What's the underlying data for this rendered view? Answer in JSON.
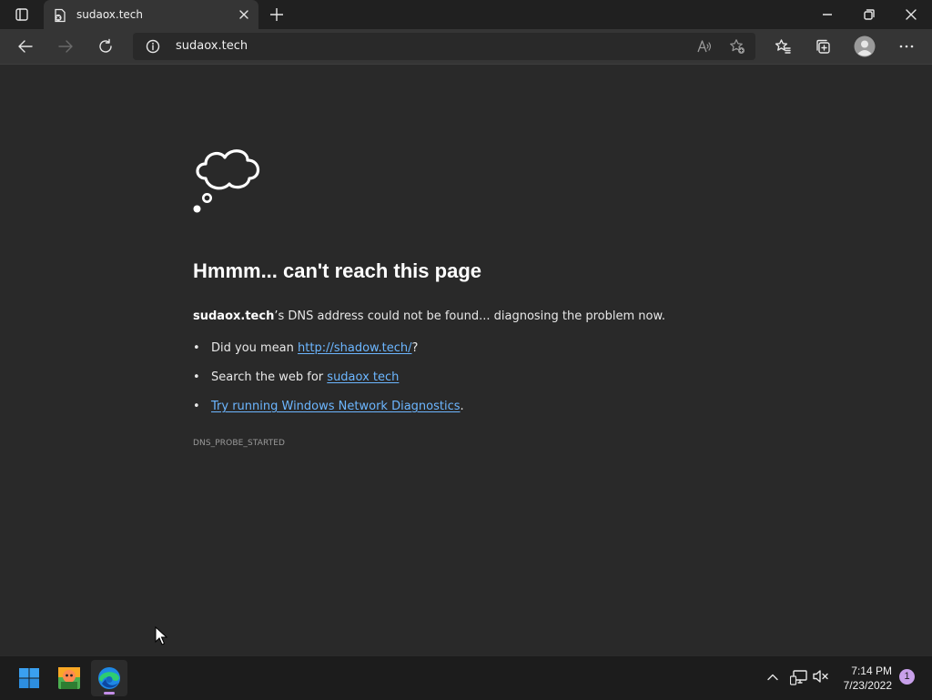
{
  "browser": {
    "tab": {
      "title": "sudaox.tech",
      "favicon": "error-page-icon"
    },
    "address_bar": {
      "url": "sudaox.tech"
    },
    "icons": {
      "tab_actions": "tab-actions-icon",
      "back": "back-icon",
      "forward": "forward-icon",
      "refresh": "refresh-icon",
      "site_info": "info-icon",
      "read_aloud": "read-aloud-icon",
      "add_favorite": "add-favorite-icon",
      "favorites": "favorites-icon",
      "collections": "collections-icon",
      "profile": "profile-icon",
      "menu": "more-icon"
    }
  },
  "error_page": {
    "icon": "thought-bubble-icon",
    "heading": "Hmmm... can't reach this page",
    "summary_host": "sudaox.tech",
    "summary_rest": "’s DNS address could not be found... diagnosing the problem now.",
    "suggestions": [
      {
        "prefix": "Did you mean ",
        "link": "http://shadow.tech/",
        "suffix": "?"
      },
      {
        "prefix": "Search the web for ",
        "link": "sudaox tech",
        "suffix": ""
      },
      {
        "prefix": "",
        "link": "Try running Windows Network Diagnostics",
        "suffix": "."
      }
    ],
    "error_code": "DNS_PROBE_STARTED"
  },
  "taskbar": {
    "apps": [
      "start-icon",
      "app-icon",
      "edge-icon"
    ],
    "tray": [
      "chevron-up-icon",
      "network-icon",
      "volume-muted-icon"
    ],
    "time": "7:14 PM",
    "date": "7/23/2022",
    "notification_count": "1"
  },
  "colors": {
    "page_background": "#292929",
    "tab_strip": "#202020",
    "toolbar": "#353535",
    "link": "#6cb6ff",
    "taskbar": "#1c1c1c",
    "accent": "#c48ee8"
  }
}
